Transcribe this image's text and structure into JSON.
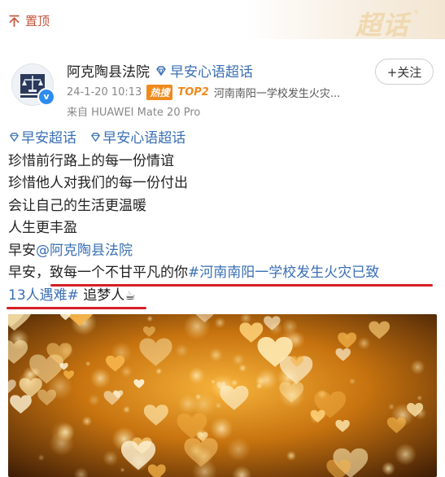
{
  "header": {
    "pin_label": "置顶",
    "supertopic_logo": "超话"
  },
  "post": {
    "author": "阿克陶县法院",
    "topic": "早安心语超话",
    "follow_label": "+关注",
    "timestamp": "24-1-20 10:13",
    "hot_badge": "热搜",
    "hot_rank": "TOP2",
    "hot_topic": "河南南阳一学校发生火灾...",
    "device": "来自 HUAWEI Mate 20 Pro"
  },
  "content": {
    "tag1": "早安超话",
    "tag2": "早安心语超话",
    "line1": "珍惜前行路上的每一份情谊",
    "line2": "珍惜他人对我们的每一份付出",
    "line3": "会让自己的生活更温暖",
    "line4": "人生更丰盈",
    "greeting": "早安",
    "mention": "@阿克陶县法院",
    "line6_prefix": "早安，",
    "line6_dedication": "致每一个不甘平凡的你",
    "hashtag_part1": "#河南南阳一学校发生火灾已致",
    "hashtag_part2": "13人遇难#",
    "closing": " 追梦人"
  },
  "colors": {
    "link_blue": "#3a6fb5",
    "hot_orange": "#f08a1c",
    "underline_red": "#d61f26",
    "pin_red": "#c6553e"
  },
  "icons": [
    "pin-icon",
    "supertopic-diamond-icon",
    "verified-icon",
    "plus-icon",
    "coffee-cup-icon"
  ]
}
